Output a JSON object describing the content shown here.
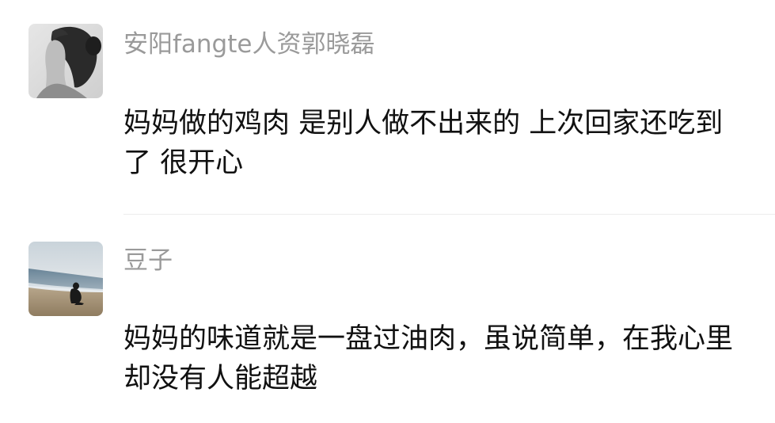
{
  "comments": [
    {
      "author": "安阳fangte人资郭晓磊",
      "avatar_icon": "grayscale-portrait-photo",
      "text": "妈妈做的鸡肉 是别人做不出来的 上次回家还吃到了 很开心"
    },
    {
      "author": "豆子",
      "avatar_icon": "beach-scenery-photo",
      "text": "妈妈的味道就是一盘过油肉，虽说简单，在我心里却没有人能超越"
    }
  ],
  "colors": {
    "author": "#9a9a9a",
    "text": "#111111",
    "divider": "#ededed",
    "background": "#ffffff"
  }
}
